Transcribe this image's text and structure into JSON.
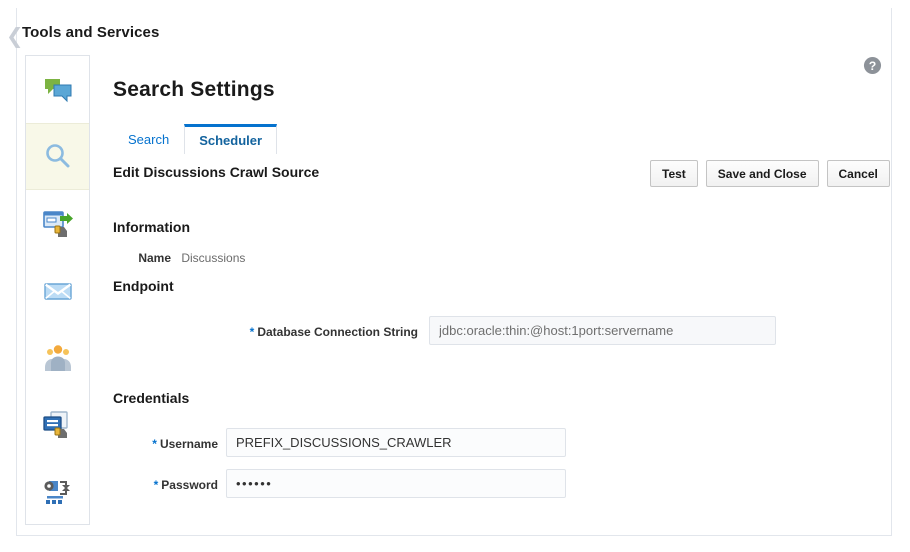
{
  "breadcrumb": {
    "back_icon": "chevron-left-icon",
    "title": "Tools and Services"
  },
  "header": {
    "help_icon": "help-icon",
    "page_title": "Search Settings"
  },
  "sidebar": {
    "items": [
      {
        "icon": "discussions-icon",
        "active": false
      },
      {
        "icon": "search-icon",
        "active": true
      },
      {
        "icon": "export-import-icon",
        "active": false
      },
      {
        "icon": "mail-icon",
        "active": false
      },
      {
        "icon": "people-connections-icon",
        "active": false
      },
      {
        "icon": "portal-server-icon",
        "active": false
      },
      {
        "icon": "workflow-icon",
        "active": false
      }
    ]
  },
  "tabs": [
    {
      "label": "Search",
      "active": false
    },
    {
      "label": "Scheduler",
      "active": true
    }
  ],
  "subheader": {
    "title": "Edit Discussions Crawl Source"
  },
  "toolbar": {
    "test_label": "Test",
    "save_and_close_label": "Save and Close",
    "cancel_label": "Cancel"
  },
  "form": {
    "information": {
      "section_title": "Information",
      "name_label": "Name",
      "name_value": "Discussions"
    },
    "endpoint": {
      "section_title": "Endpoint",
      "db_conn_label": "Database Connection String",
      "db_conn_value": "jdbc:oracle:thin:@host:1port:servername",
      "db_conn_required": "*"
    },
    "credentials": {
      "section_title": "Credentials",
      "username_label": "Username",
      "username_value": "PREFIX_DISCUSSIONS_CRAWLER",
      "username_required": "*",
      "password_label": "Password",
      "password_value": "••••••",
      "password_required": "*"
    }
  },
  "colors": {
    "accent_blue": "#0572ce",
    "link_blue": "#0572ce",
    "active_rail_bg": "#f8f8e8",
    "border": "#dfe3e9",
    "text": "#333333"
  }
}
